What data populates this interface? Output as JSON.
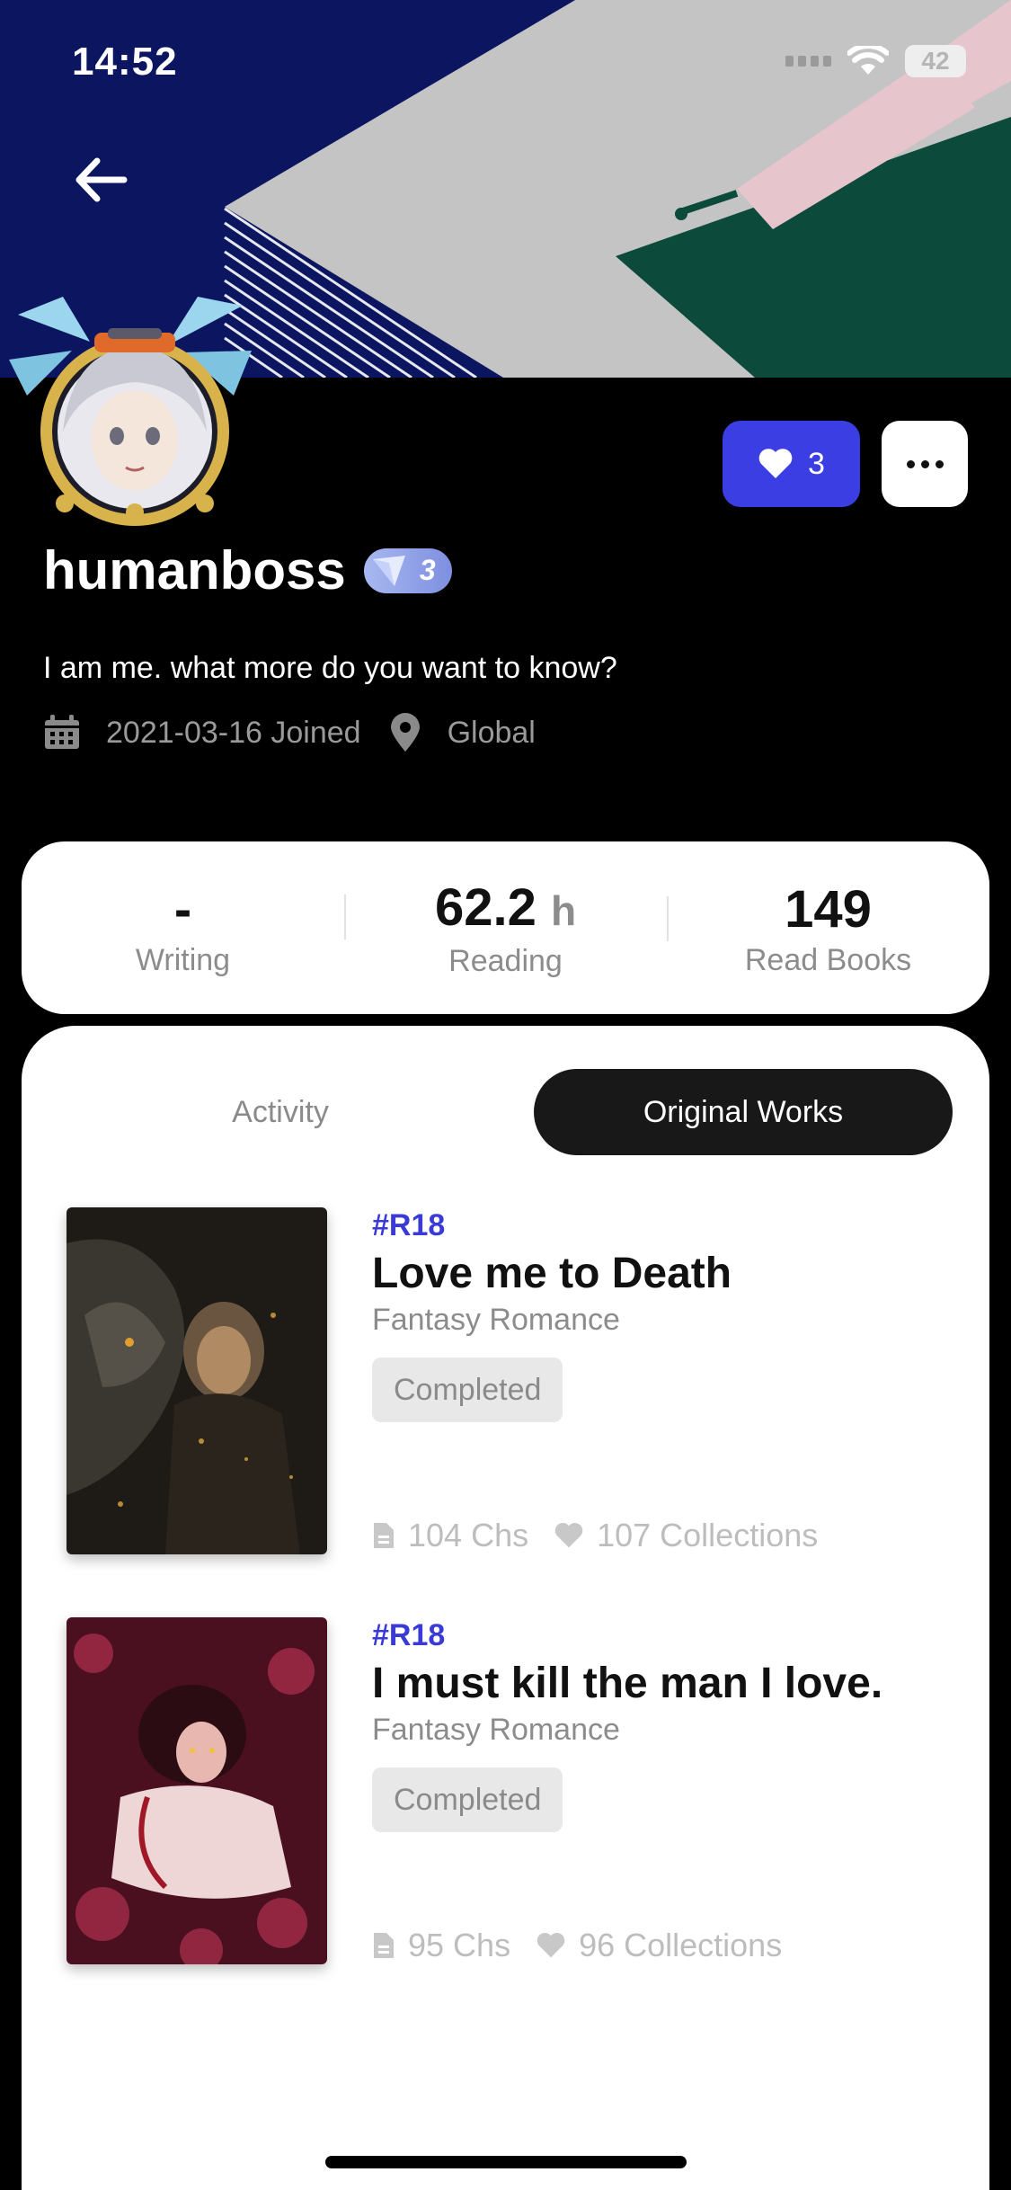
{
  "status_bar": {
    "time": "14:52",
    "battery": "42"
  },
  "header": {
    "back_icon": "arrow-left-icon"
  },
  "profile": {
    "username": "humanboss",
    "level": "3",
    "bio": "I am me. what more do you want to know?",
    "joined": "2021-03-16 Joined",
    "location": "Global",
    "likes": "3"
  },
  "stats": {
    "writing": {
      "value": "-",
      "unit": "",
      "label": "Writing"
    },
    "reading": {
      "value": "62.2",
      "unit": "h",
      "label": "Reading"
    },
    "read_books": {
      "value": "149",
      "unit": "",
      "label": "Read Books"
    }
  },
  "tabs": {
    "activity": "Activity",
    "original_works": "Original Works"
  },
  "books": [
    {
      "tag": "#R18",
      "title": "Love me to Death",
      "genre": "Fantasy Romance",
      "status": "Completed",
      "chapters": "104 Chs",
      "collections": "107 Collections"
    },
    {
      "tag": "#R18",
      "title": "I must kill the man I love.",
      "genre": "Fantasy Romance",
      "status": "Completed",
      "chapters": "95 Chs",
      "collections": "96 Collections"
    }
  ],
  "colors": {
    "accent": "#3b3fe3",
    "banner_navy": "#0b1560",
    "banner_green": "#0c4a3b",
    "tag": "#3a3ad6"
  }
}
